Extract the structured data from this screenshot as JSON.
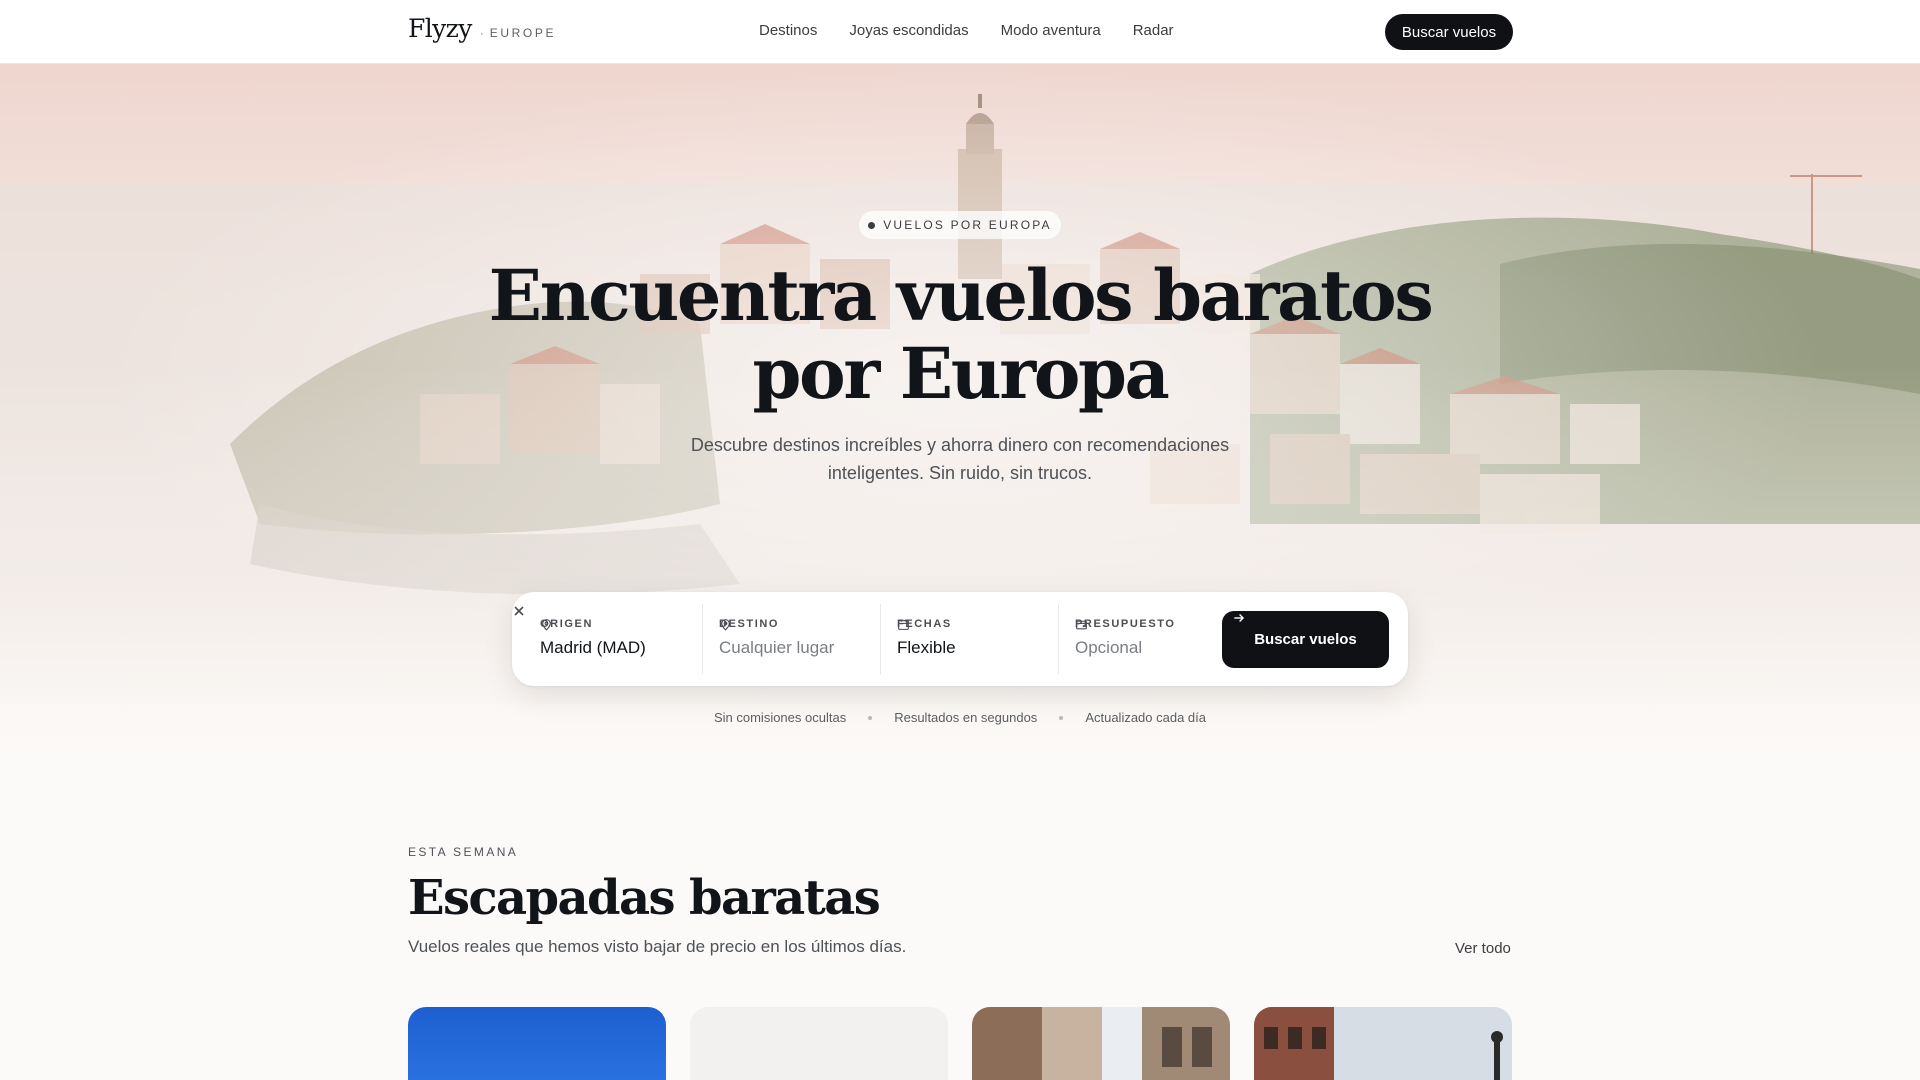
{
  "nav": {
    "brand": "Flyzy",
    "brand_separator": "·",
    "brand_region": "EUROPE",
    "links": [
      "Destinos",
      "Joyas escondidas",
      "Modo aventura",
      "Radar"
    ],
    "cta_label": "Buscar vuelos"
  },
  "hero": {
    "badge": "VUELOS POR EUROPA",
    "title_line1": "Encuentra vuelos baratos",
    "title_line2": "por Europa",
    "subtitle_line1": "Descubre destinos increíbles y ahorra dinero con recomendaciones",
    "subtitle_line2": "inteligentes. Sin ruido, sin trucos."
  },
  "search": {
    "origin": {
      "label": "ORIGEN",
      "value": "Madrid (MAD)",
      "icon": "map-pin-icon"
    },
    "destination": {
      "label": "DESTINO",
      "placeholder": "Cualquier lugar",
      "icon": "map-pin-icon"
    },
    "dates": {
      "label": "FECHAS",
      "value": "Flexible",
      "icon": "calendar-icon"
    },
    "budget": {
      "label": "PRESUPUESTO",
      "placeholder": "Opcional",
      "icon": "wallet-icon"
    },
    "submit_label": "Buscar vuelos"
  },
  "features": [
    "Sin comisiones ocultas",
    "Resultados en segundos",
    "Actualizado cada día"
  ],
  "section": {
    "eyebrow": "ESTA SEMANA",
    "title": "Escapadas baratas",
    "subtitle": "Vuelos reales que hemos visto bajar de precio en los últimos días.",
    "see_all": "Ver todo"
  },
  "colors": {
    "primary": "#0f1115",
    "background": "#fcfaf8",
    "text": "#111418",
    "muted": "#4e5257"
  }
}
